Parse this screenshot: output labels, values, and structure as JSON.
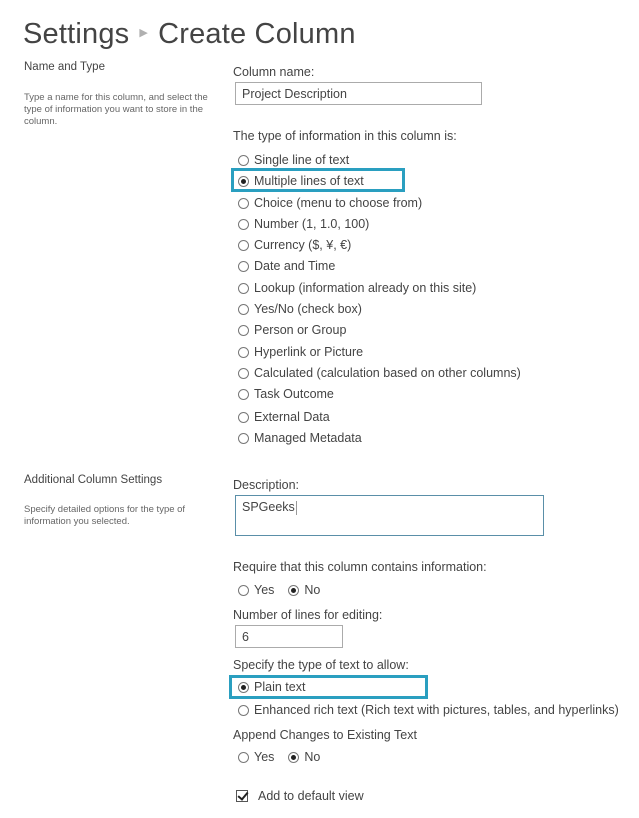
{
  "header": {
    "breadcrumb_root": "Settings",
    "separator_icon": "chevron-right-icon",
    "page_title": "Create Column"
  },
  "name_and_type": {
    "heading": "Name and Type",
    "description": "Type a name for this column, and select the type of information you want to store in the column.",
    "column_name_label": "Column name:",
    "column_name_value": "Project Description",
    "type_label": "The type of information in this column is:",
    "types": [
      {
        "label": "Single line of text",
        "checked": false
      },
      {
        "label": "Multiple lines of text",
        "checked": true
      },
      {
        "label": "Choice (menu to choose from)",
        "checked": false
      },
      {
        "label": "Number (1, 1.0, 100)",
        "checked": false
      },
      {
        "label": "Currency ($, ¥, €)",
        "checked": false
      },
      {
        "label": "Date and Time",
        "checked": false
      },
      {
        "label": "Lookup (information already on this site)",
        "checked": false
      },
      {
        "label": "Yes/No (check box)",
        "checked": false
      },
      {
        "label": "Person or Group",
        "checked": false
      },
      {
        "label": "Hyperlink or Picture",
        "checked": false
      },
      {
        "label": "Calculated (calculation based on other columns)",
        "checked": false
      },
      {
        "label": "Task Outcome",
        "checked": false
      },
      {
        "label": "External Data",
        "checked": false
      },
      {
        "label": "Managed Metadata",
        "checked": false
      }
    ]
  },
  "additional": {
    "heading": "Additional Column Settings",
    "description": "Specify detailed options for the type of information you selected.",
    "description_label": "Description:",
    "description_value": "SPGeeks",
    "require_label": "Require that this column contains information:",
    "require_options": [
      {
        "label": "Yes",
        "checked": false
      },
      {
        "label": "No",
        "checked": true
      }
    ],
    "lines_label": "Number of lines for editing:",
    "lines_value": "6",
    "text_type_label": "Specify the type of text to allow:",
    "text_types": [
      {
        "label": "Plain text",
        "checked": true
      },
      {
        "label": "Enhanced rich text (Rich text with pictures, tables, and hyperlinks)",
        "checked": false
      }
    ],
    "append_label": "Append Changes to Existing Text",
    "append_options": [
      {
        "label": "Yes",
        "checked": false
      },
      {
        "label": "No",
        "checked": true
      }
    ],
    "default_view_label": "Add to default view",
    "default_view_checked": true
  },
  "colors": {
    "highlight": "#2a9fc0",
    "text": "#444444"
  }
}
